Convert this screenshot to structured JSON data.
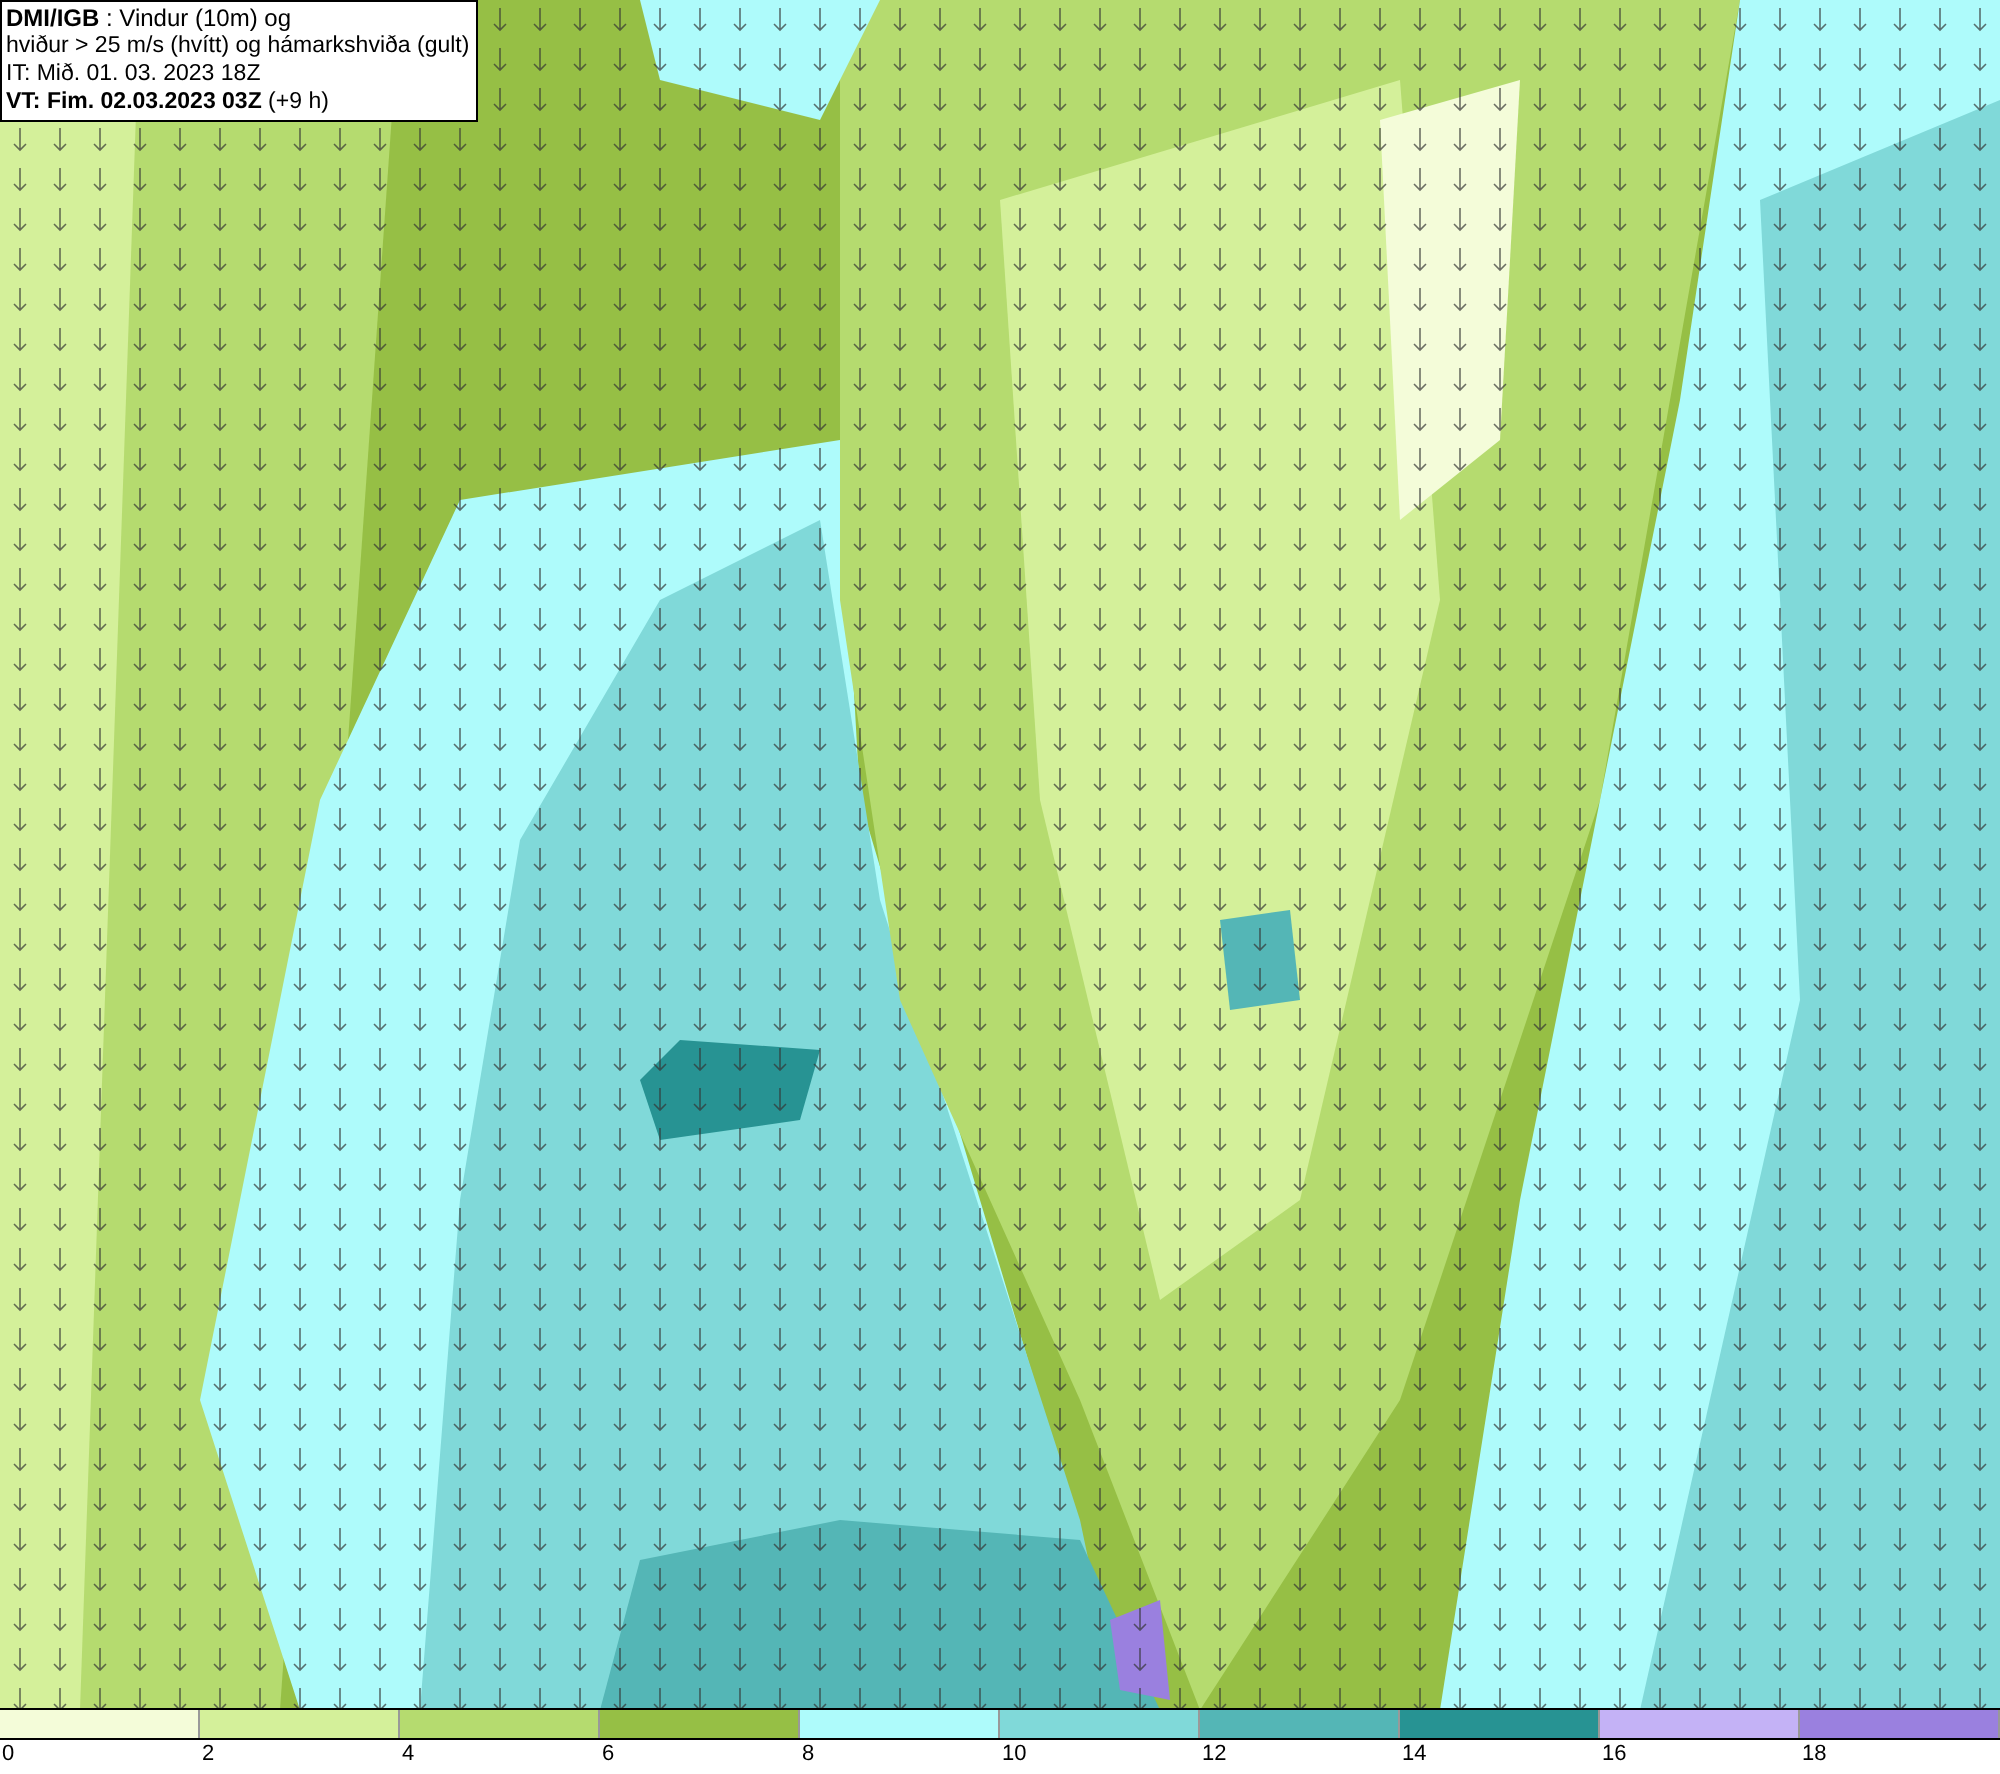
{
  "header": {
    "lines": [
      "**DMI/IGB** : Vindur (10m) og",
      "hviður > 25 m/s (hvítt) og hámarkshviða (gult)",
      "IT: Mið. 01. 03. 2023 18Z",
      "**VT: Fim. 02.03.2023 03Z** (+9 h)"
    ]
  },
  "legend": [
    {
      "label": "0",
      "color": "#f4fcd9"
    },
    {
      "label": "2",
      "color": "#d4f09a"
    },
    {
      "label": "4",
      "color": "#b5db6f"
    },
    {
      "label": "6",
      "color": "#96bf45"
    },
    {
      "label": "8",
      "color": "#aefbfb"
    },
    {
      "label": "10",
      "color": "#80d9d9"
    },
    {
      "label": "12",
      "color": "#54b6b6"
    },
    {
      "label": "14",
      "color": "#279393"
    },
    {
      "label": "16",
      "color": "#c4b2f6"
    },
    {
      "label": "18",
      "color": "#9a80df"
    }
  ]
}
